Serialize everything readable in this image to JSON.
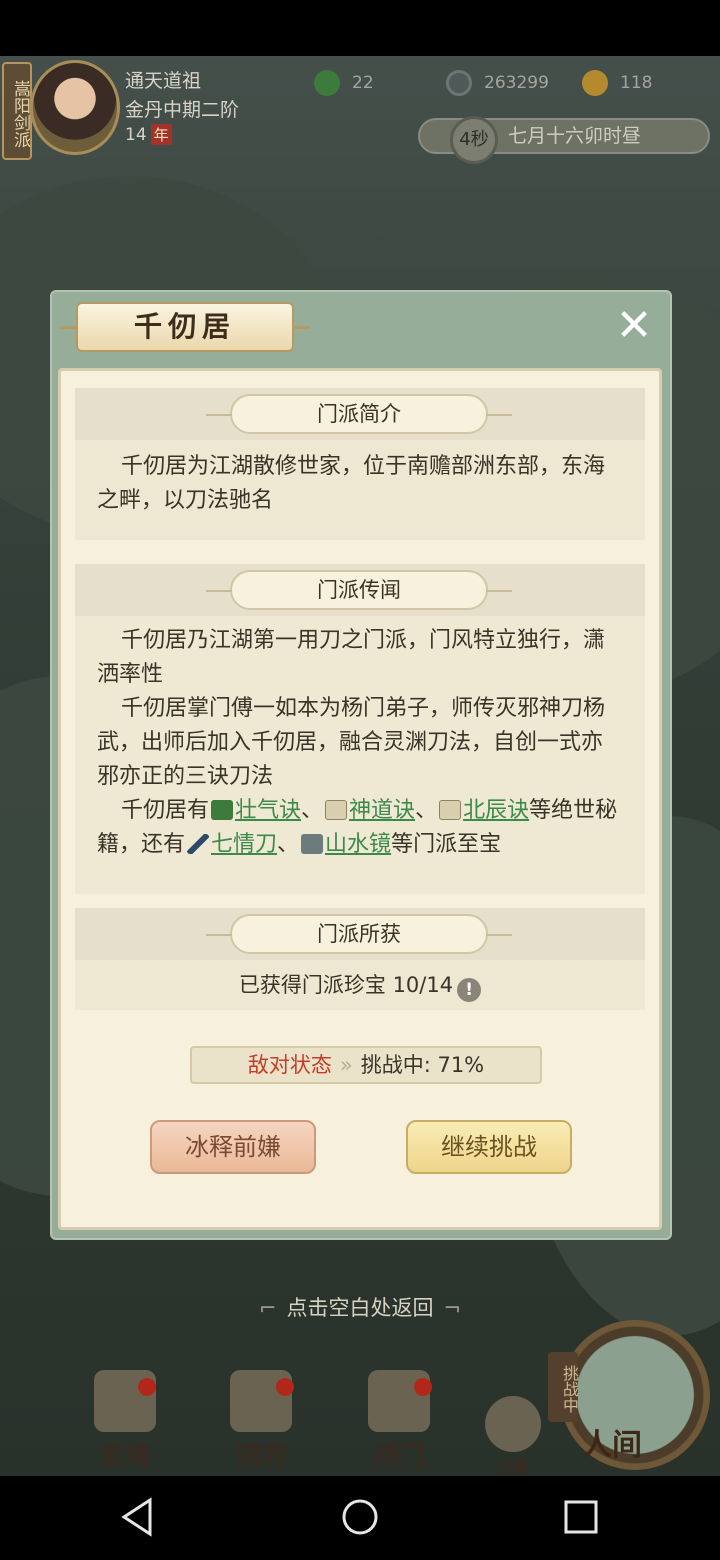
{
  "player": {
    "sect_badge": "嵩阳剑派",
    "name": "通天道祖",
    "realm": "金丹中期二阶",
    "years": "14",
    "years_tag": "年"
  },
  "resources": {
    "jade": "22",
    "coins": "263299",
    "power": "118"
  },
  "time": {
    "countdown": "4秒",
    "date": "七月十六卯时昼"
  },
  "modal": {
    "title": "千仞居",
    "close_icon": "close-icon",
    "sections": {
      "intro_header": "门派简介",
      "intro_text": "千仞居为江湖散修世家，位于南赡部洲东部，东海之畔，以刀法驰名",
      "lore_header": "门派传闻",
      "lore_p1": "千仞居乃江湖第一用刀之门派，门风特立独行，潇洒率性",
      "lore_p2": "千仞居掌门傅一如本为杨门弟子，师传灭邪神刀杨武，出师后加入千仞居，融合灵渊刀法，自创一式亦邪亦正的三诀刀法",
      "lore_p3_prefix": "千仞居有",
      "lore_link_1": "壮气诀",
      "lore_sep_1": "、",
      "lore_link_2": "神道诀",
      "lore_sep_2": "、",
      "lore_link_3": "北辰诀",
      "lore_mid": "等绝世秘籍，还有",
      "lore_link_4": "七情刀",
      "lore_sep_3": "、",
      "lore_link_5": "山水镜",
      "lore_suffix": "等门派至宝",
      "gain_header": "门派所获",
      "treasure_label": "已获得门派珍宝 10/14",
      "treasure_info_icon": "!"
    },
    "status": {
      "hostile": "敌对状态",
      "arrow": "»",
      "challenge": "挑战中: 71%"
    },
    "buttons": {
      "forgive": "冰释前嫌",
      "continue": "继续挑战"
    }
  },
  "return_hint": "点击空白处返回",
  "bottom_nav": {
    "items": [
      {
        "label": "玄境"
      },
      {
        "label": "洞府"
      },
      {
        "label": "师门"
      },
      {
        "label": "行囊"
      }
    ],
    "challenge_tag": "挑战中",
    "human_world": "人间"
  },
  "colors": {
    "hostile": "#c63c2b",
    "link": "#3c8a4a",
    "modal_frame": "#96ad99",
    "panel": "#f6f0dc"
  }
}
